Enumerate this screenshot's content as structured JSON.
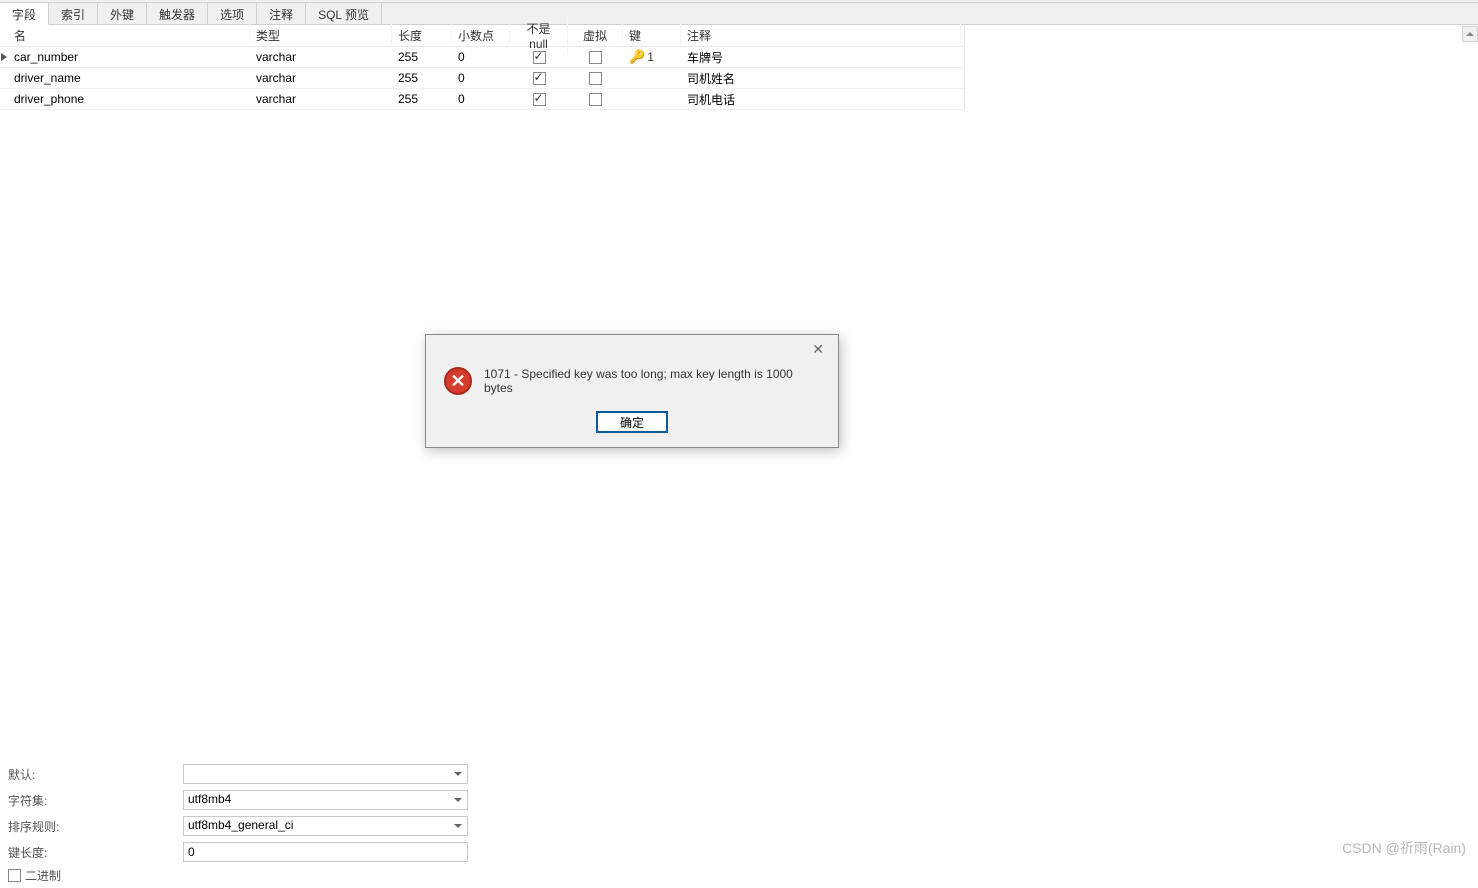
{
  "tabs": {
    "fields": "字段",
    "indexes": "索引",
    "foreign_keys": "外键",
    "triggers": "触发器",
    "options": "选项",
    "comments": "注释",
    "sql_preview": "SQL 预览"
  },
  "headers": {
    "name": "名",
    "type": "类型",
    "length": "长度",
    "decimal": "小数点",
    "not_null": "不是 null",
    "virtual": "虚拟",
    "key": "键",
    "comment": "注释"
  },
  "rows": [
    {
      "name": "car_number",
      "type": "varchar",
      "length": "255",
      "decimal": "0",
      "not_null": true,
      "virtual": false,
      "key": "1",
      "comment": "车牌号",
      "active": true
    },
    {
      "name": "driver_name",
      "type": "varchar",
      "length": "255",
      "decimal": "0",
      "not_null": true,
      "virtual": false,
      "key": "",
      "comment": "司机姓名",
      "active": false
    },
    {
      "name": "driver_phone",
      "type": "varchar",
      "length": "255",
      "decimal": "0",
      "not_null": true,
      "virtual": false,
      "key": "",
      "comment": "司机电话",
      "active": false
    }
  ],
  "form": {
    "default_label": "默认:",
    "default_value": "",
    "charset_label": "字符集:",
    "charset_value": "utf8mb4",
    "collation_label": "排序规则:",
    "collation_value": "utf8mb4_general_ci",
    "keylength_label": "键长度:",
    "keylength_value": "0",
    "binary_label": "二进制"
  },
  "dialog": {
    "message": "1071 - Specified key was too long; max key length is 1000 bytes",
    "ok": "确定"
  },
  "watermark": "CSDN @祈雨(Rain)"
}
